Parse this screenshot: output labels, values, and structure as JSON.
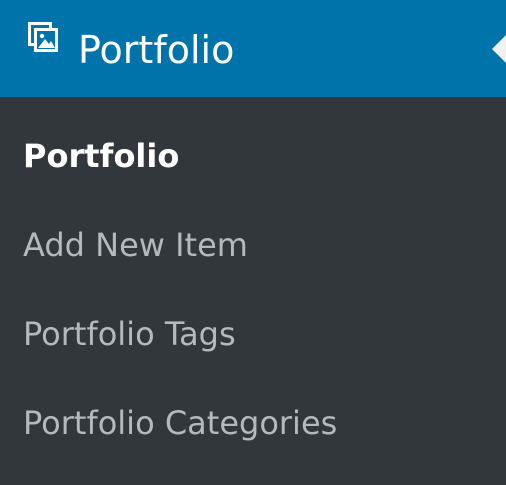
{
  "menu": {
    "title": "Portfolio",
    "icon": "portfolio-icon",
    "colors": {
      "header_background": "#0073aa",
      "sidebar_background": "#32373c",
      "current_item_text": "#ffffff",
      "item_text": "#b4b9be"
    }
  },
  "submenu": {
    "items": [
      {
        "label": "Portfolio",
        "current": true
      },
      {
        "label": "Add New Item",
        "current": false
      },
      {
        "label": "Portfolio Tags",
        "current": false
      },
      {
        "label": "Portfolio Categories",
        "current": false
      }
    ]
  }
}
